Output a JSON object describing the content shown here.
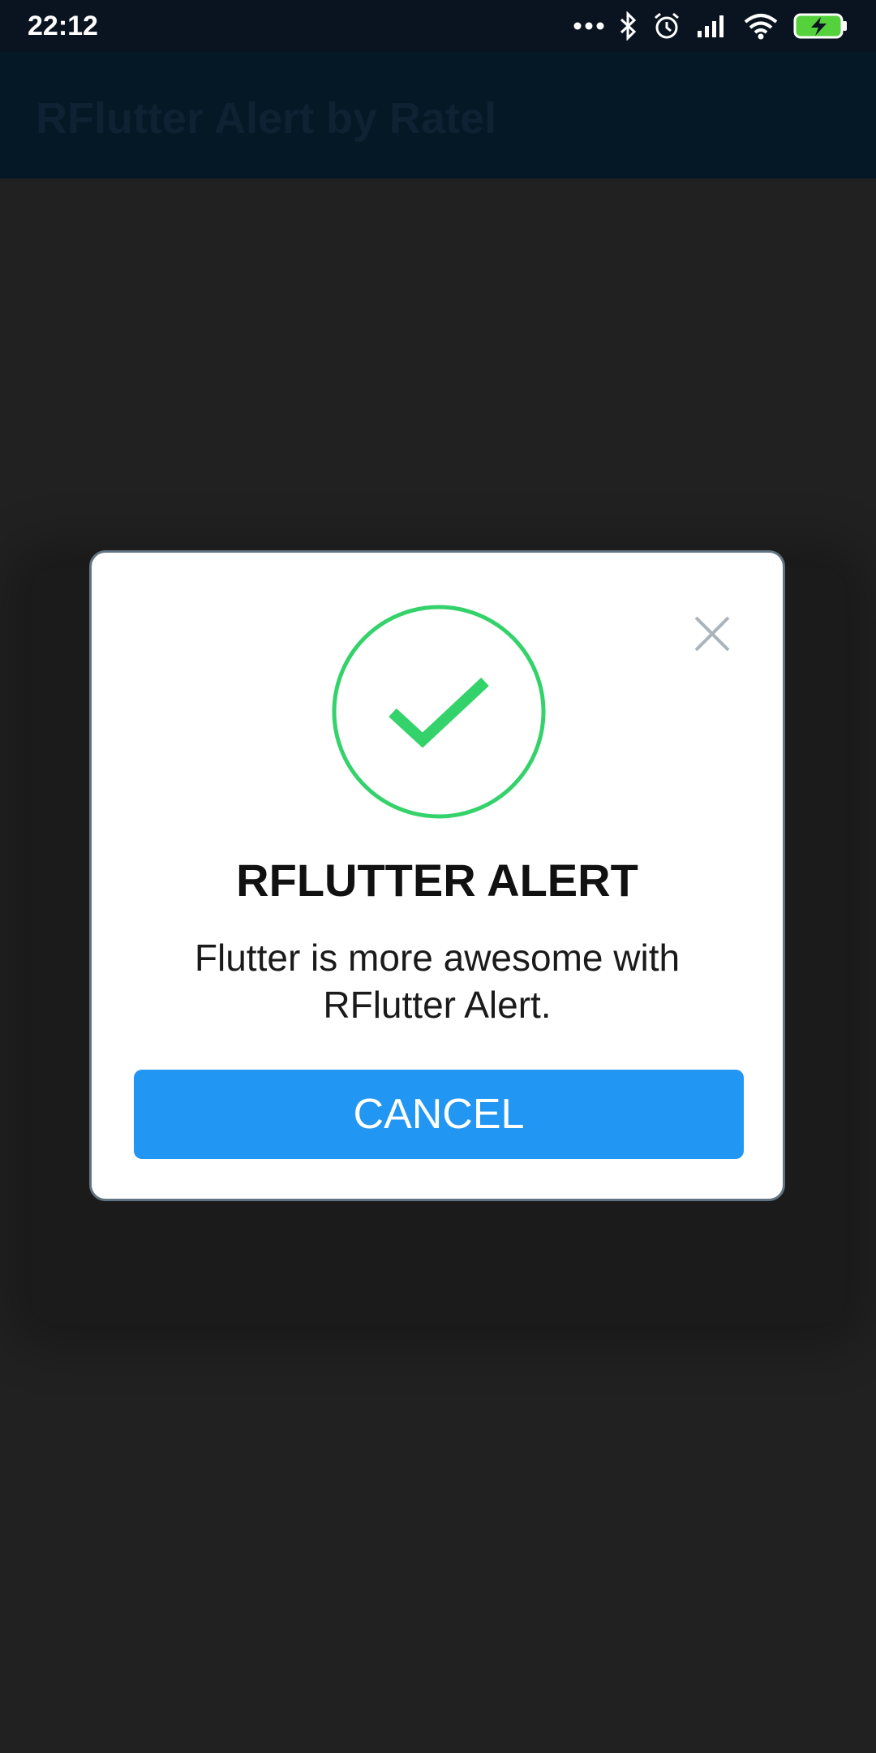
{
  "status_bar": {
    "time": "22:12",
    "icons": [
      "more-dots-icon",
      "bluetooth-icon",
      "alarm-icon",
      "cellular-signal-icon",
      "wifi-icon",
      "battery-charging-icon"
    ]
  },
  "app_bar": {
    "title": "RFlutter Alert by Ratel"
  },
  "dialog": {
    "icon": "success-check-icon",
    "title": "RFLUTTER ALERT",
    "description": "Flutter is more awesome with RFlutter Alert.",
    "button_label": "CANCEL",
    "close_icon": "close-icon"
  },
  "colors": {
    "accent_button": "#2296f3",
    "success_green": "#34d26a",
    "app_bar": "#051826",
    "background": "#212121"
  }
}
